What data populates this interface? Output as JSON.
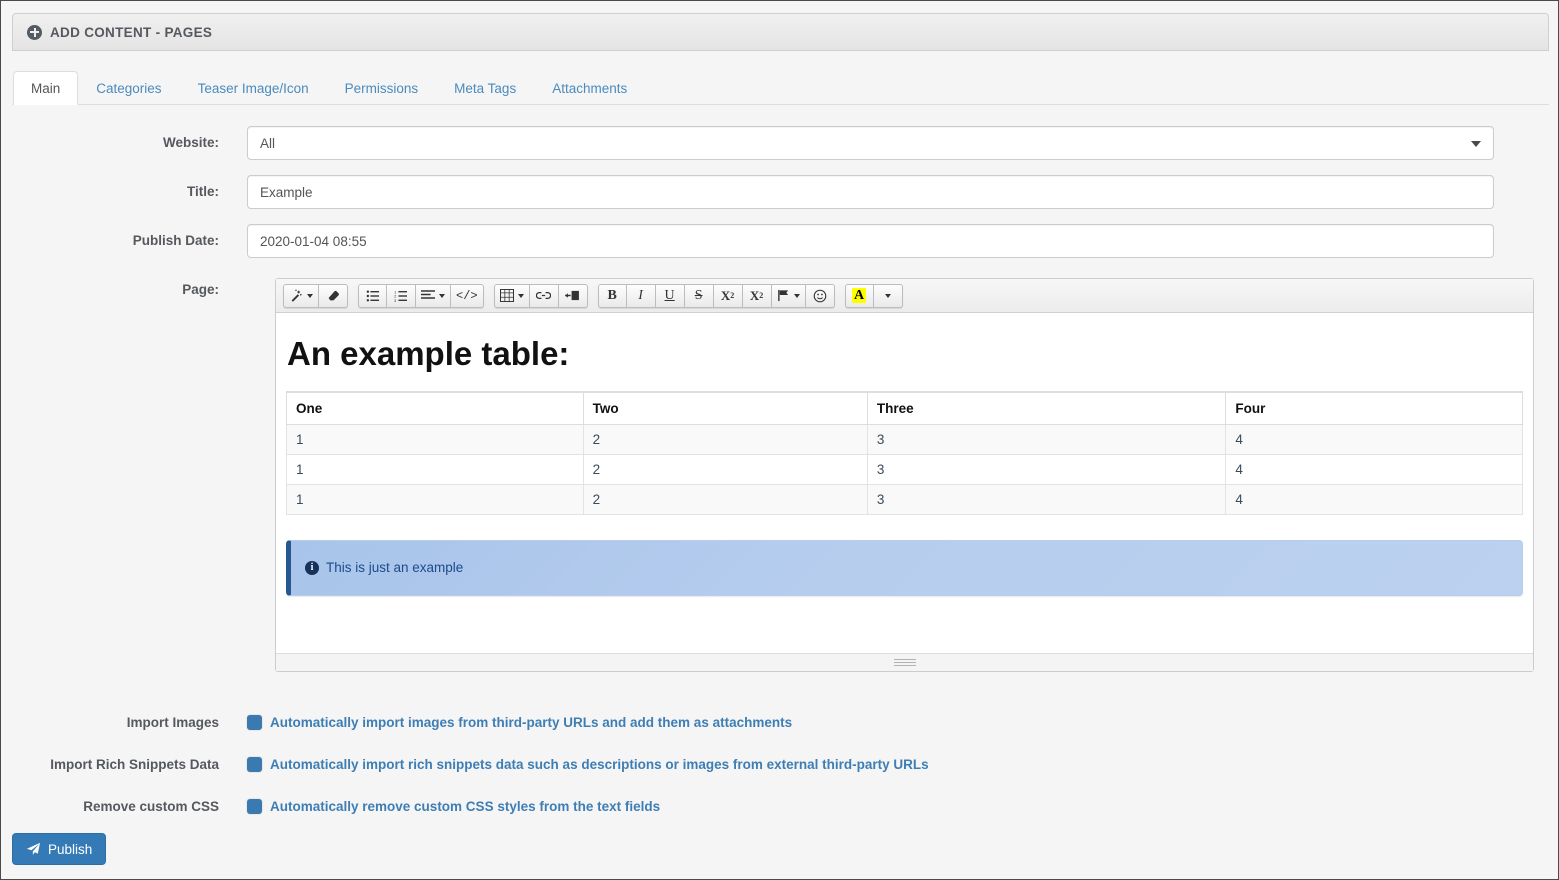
{
  "header": {
    "title": "ADD CONTENT - PAGES",
    "icon": "plus-circle-icon"
  },
  "tabs": [
    {
      "label": "Main",
      "active": true
    },
    {
      "label": "Categories",
      "active": false
    },
    {
      "label": "Teaser Image/Icon",
      "active": false
    },
    {
      "label": "Permissions",
      "active": false
    },
    {
      "label": "Meta Tags",
      "active": false
    },
    {
      "label": "Attachments",
      "active": false
    }
  ],
  "form": {
    "website": {
      "label": "Website:",
      "value": "All",
      "options": [
        "All"
      ]
    },
    "title": {
      "label": "Title:",
      "value": "Example",
      "placeholder": ""
    },
    "publish_date": {
      "label": "Publish Date:",
      "value": "2020-01-04 08:55",
      "placeholder": ""
    },
    "page": {
      "label": "Page:"
    }
  },
  "editor": {
    "toolbar_groups": [
      {
        "buttons": [
          {
            "name": "magic-wand-icon",
            "icon": "magic",
            "caret": true
          },
          {
            "name": "eraser-icon",
            "icon": "eraser",
            "caret": false
          }
        ]
      },
      {
        "buttons": [
          {
            "name": "unordered-list-icon",
            "icon": "ul",
            "caret": false
          },
          {
            "name": "ordered-list-icon",
            "icon": "ol",
            "caret": false
          },
          {
            "name": "align-icon",
            "icon": "align",
            "caret": true
          },
          {
            "name": "code-icon",
            "icon": "code",
            "label": "</>",
            "caret": false
          }
        ]
      },
      {
        "buttons": [
          {
            "name": "table-icon",
            "icon": "table",
            "caret": true
          },
          {
            "name": "link-icon",
            "icon": "link",
            "caret": false
          },
          {
            "name": "page-break-icon",
            "icon": "pagebreak",
            "caret": false
          }
        ]
      },
      {
        "buttons": [
          {
            "name": "bold-icon",
            "icon": "bold",
            "label": "B",
            "caret": false
          },
          {
            "name": "italic-icon",
            "icon": "italic",
            "label": "I",
            "caret": false
          },
          {
            "name": "underline-icon",
            "icon": "underline",
            "label": "U",
            "caret": false
          },
          {
            "name": "strikethrough-icon",
            "icon": "strike",
            "label": "S",
            "caret": false
          },
          {
            "name": "superscript-icon",
            "icon": "sup",
            "label": "X2",
            "caret": false
          },
          {
            "name": "subscript-icon",
            "icon": "sub",
            "label": "X2",
            "caret": false
          },
          {
            "name": "flag-icon",
            "icon": "flag",
            "caret": true
          },
          {
            "name": "emoticon-icon",
            "icon": "smiley",
            "caret": false
          }
        ]
      },
      {
        "buttons": [
          {
            "name": "text-color-icon",
            "icon": "colorA",
            "label": "A",
            "caret": false
          },
          {
            "name": "text-color-dropdown-icon",
            "icon": "caretonly",
            "caret": true
          }
        ]
      }
    ],
    "content": {
      "heading": "An example table:",
      "table": {
        "headers": [
          "One",
          "Two",
          "Three",
          "Four"
        ],
        "rows": [
          [
            "1",
            "2",
            "3",
            "4"
          ],
          [
            "1",
            "2",
            "3",
            "4"
          ],
          [
            "1",
            "2",
            "3",
            "4"
          ]
        ]
      },
      "alert": {
        "icon": "info-circle-icon",
        "text": "This is just an example"
      }
    },
    "resize_handle": "resize-grip"
  },
  "options": [
    {
      "label": "Import Images",
      "text": "Automatically import images from third-party URLs and add them as attachments",
      "checked": true
    },
    {
      "label": "Import Rich Snippets Data",
      "text": "Automatically import rich snippets data such as descriptions or images from external third-party URLs",
      "checked": true
    },
    {
      "label": "Remove custom CSS",
      "text": "Automatically remove custom CSS styles from the text fields",
      "checked": true
    }
  ],
  "actions": {
    "publish": {
      "label": "Publish",
      "icon": "paper-plane-icon"
    }
  },
  "colors": {
    "accent": "#337ab7",
    "link": "#4b8bbd",
    "label": "#55595e",
    "alert_border": "#26578f",
    "checkbox": "#3a7ab0",
    "highlight": "#ffff00"
  }
}
